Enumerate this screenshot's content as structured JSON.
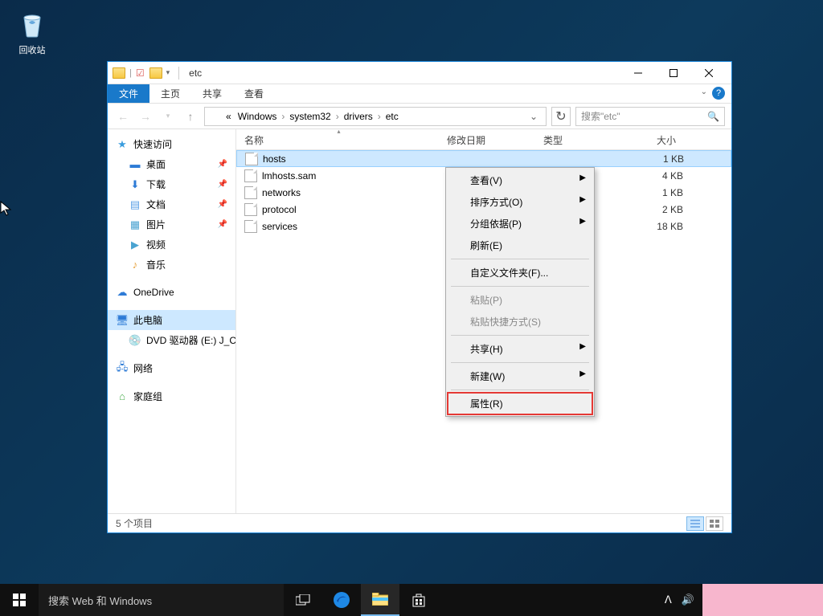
{
  "desktop": {
    "recycle_bin": "回收站"
  },
  "titlebar": {
    "title": "etc"
  },
  "ribbon": {
    "file": "文件",
    "home": "主页",
    "share": "共享",
    "view": "查看"
  },
  "breadcrumb": {
    "prefix": "«",
    "items": [
      "Windows",
      "system32",
      "drivers",
      "etc"
    ]
  },
  "search": {
    "placeholder": "搜索\"etc\""
  },
  "sidebar": {
    "quick_access": "快速访问",
    "desktop": "桌面",
    "downloads": "下载",
    "documents": "文档",
    "pictures": "图片",
    "videos": "视频",
    "music": "音乐",
    "onedrive": "OneDrive",
    "this_pc": "此电脑",
    "dvd": "DVD 驱动器 (E:) J_C",
    "network": "网络",
    "homegroup": "家庭组"
  },
  "columns": {
    "name": "名称",
    "date": "修改日期",
    "type": "类型",
    "size": "大小"
  },
  "files": [
    {
      "name": "hosts",
      "size": "1 KB",
      "selected": true
    },
    {
      "name": "lmhosts.sam",
      "size": "4 KB"
    },
    {
      "name": "networks",
      "size": "1 KB"
    },
    {
      "name": "protocol",
      "size": "2 KB"
    },
    {
      "name": "services",
      "size": "18 KB"
    }
  ],
  "context_menu": {
    "view": "查看(V)",
    "sort": "排序方式(O)",
    "group": "分组依据(P)",
    "refresh": "刷新(E)",
    "customize": "自定义文件夹(F)...",
    "paste": "粘贴(P)",
    "paste_shortcut": "粘贴快捷方式(S)",
    "share": "共享(H)",
    "new": "新建(W)",
    "properties": "属性(R)"
  },
  "statusbar": {
    "items": "5 个项目"
  },
  "taskbar": {
    "search_placeholder": "搜索 Web 和 Windows"
  }
}
